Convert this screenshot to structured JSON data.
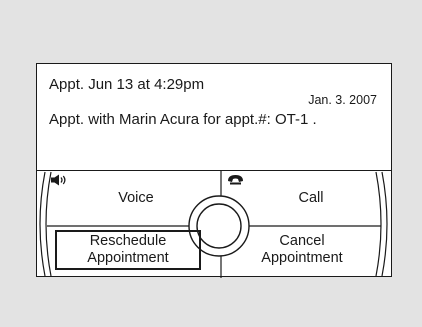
{
  "message": {
    "appointment_time": "Appt. Jun  13 at  4:29pm",
    "date": "Jan. 3. 2007",
    "detail": "Appt. with Marin Acura for appt.#: OT-1 ."
  },
  "controls": {
    "voice_label": "Voice",
    "voice_icon": "speaker-icon",
    "call_label": "Call",
    "call_icon": "phone-icon",
    "reschedule_line1": "Reschedule",
    "reschedule_line2": "Appointment",
    "cancel_line1": "Cancel",
    "cancel_line2": "Appointment"
  }
}
